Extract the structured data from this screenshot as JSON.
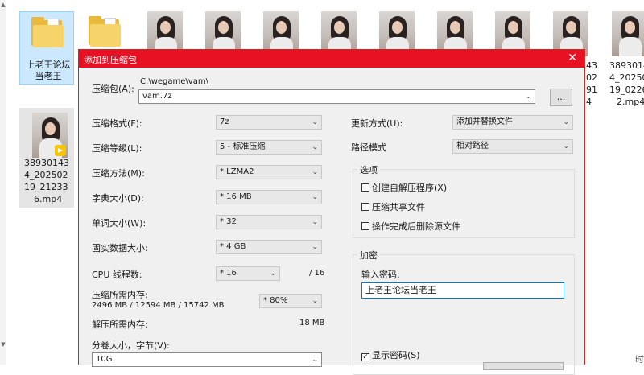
{
  "explorer": {
    "folder_name": "上老王论坛当老王",
    "file_name_1": [
      "38930143",
      "4_202502",
      "19_21233",
      "6.mp4"
    ],
    "file_name_2": [
      "3893014",
      "4_20250",
      "19_0226",
      "2.mp4"
    ],
    "partial_names": [
      "43",
      "02",
      "91",
      "4"
    ],
    "right_edge_text": "时",
    "badge_icon": "play-badge-icon"
  },
  "dialog": {
    "title": "添加到压缩包",
    "close_glyph": "✕",
    "archive_label": "压缩包(A):",
    "archive_dir": "C:\\wegame\\vam\\",
    "archive_name": "vam.7z",
    "browse_label": "...",
    "left": {
      "format_label": "压缩格式(F):",
      "format_value": "7z",
      "level_label": "压缩等级(L):",
      "level_value": "5 - 标准压缩",
      "method_label": "压缩方法(M):",
      "method_value": "* LZMA2",
      "dict_label": "字典大小(D):",
      "dict_value": "* 16 MB",
      "word_label": "单词大小(W):",
      "word_value": "* 32",
      "solid_label": "固实数据大小:",
      "solid_value": "* 4 GB",
      "cpu_label": "CPU 线程数:",
      "cpu_value": "* 16",
      "cpu_total": "/ 16",
      "mem_label": "压缩所需内存:",
      "mem_detail": "2496 MB / 12594 MB / 15742 MB",
      "mem_percent": "* 80%",
      "decomp_label": "解压所需内存:",
      "decomp_value": "18 MB",
      "split_label": "分卷大小，字节(V):",
      "split_value": "10G"
    },
    "right": {
      "update_label": "更新方式(U):",
      "update_value": "添加并替换文件",
      "path_label": "路径模式",
      "path_value": "相对路径",
      "options_title": "选项",
      "opt_sfx": "创建自解压程序(X)",
      "opt_shared": "压缩共享文件",
      "opt_delete": "操作完成后删除源文件",
      "encrypt_title": "加密",
      "password_label": "输入密码:",
      "password_value": "上老王论坛当老王",
      "show_password": "显示密码(S)",
      "checked_glyph": "✓"
    },
    "dropdown_glyph": "⌄"
  }
}
